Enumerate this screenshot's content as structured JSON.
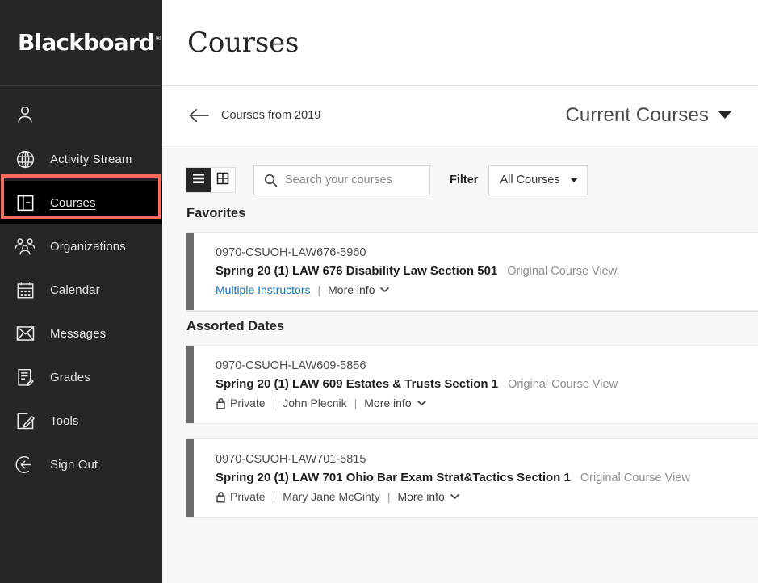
{
  "brand": {
    "logo_text": "Blackboard",
    "accent_highlight": "#fc6a5d",
    "sidebar_bg": "#262626",
    "link_color": "#1d6da8"
  },
  "sidebar": {
    "items": [
      {
        "label": "",
        "icon": "person-icon",
        "name": "profile",
        "active": false
      },
      {
        "label": "Activity Stream",
        "icon": "globe-icon",
        "name": "activity-stream",
        "active": false
      },
      {
        "label": "Courses",
        "icon": "book-icon",
        "name": "courses",
        "active": true
      },
      {
        "label": "Organizations",
        "icon": "people-icon",
        "name": "organizations",
        "active": false
      },
      {
        "label": "Calendar",
        "icon": "calendar-icon",
        "name": "calendar",
        "active": false
      },
      {
        "label": "Messages",
        "icon": "envelope-icon",
        "name": "messages",
        "active": false
      },
      {
        "label": "Grades",
        "icon": "grades-icon",
        "name": "grades",
        "active": false
      },
      {
        "label": "Tools",
        "icon": "tools-pencil-icon",
        "name": "tools",
        "active": false
      },
      {
        "label": "Sign Out",
        "icon": "sign-out-icon",
        "name": "sign-out",
        "active": false
      }
    ]
  },
  "header": {
    "title": "Courses"
  },
  "sub_header": {
    "back_label": "Courses from 2019",
    "back_icon": "arrow-left-icon",
    "term_selected": "Current Courses",
    "term_caret_icon": "chevron-down-icon"
  },
  "toolbar": {
    "list_view_icon": "list-view-icon",
    "grid_view_icon": "grid-view-icon",
    "active_view": "list",
    "search": {
      "icon": "search-icon",
      "value": "",
      "placeholder": "Search your courses"
    },
    "filter_label": "Filter",
    "filter_selected": "All Courses",
    "filter_caret_icon": "chevron-down-icon"
  },
  "sections": [
    {
      "title": "Favorites",
      "courses": [
        {
          "id": "0970-CSUOH-LAW676-5960",
          "name": "Spring 20 (1) LAW 676 Disability Law Section 501",
          "view": "Original Course View",
          "privacy": null,
          "privacy_icon": null,
          "instructor": "Multiple Instructors",
          "instructor_is_link": true,
          "more_info": "More info",
          "more_info_icon": "chevron-down-icon",
          "accent_color": "#6b6b6b"
        }
      ]
    },
    {
      "title": "Assorted Dates",
      "courses": [
        {
          "id": "0970-CSUOH-LAW609-5856",
          "name": "Spring 20 (1) LAW 609 Estates & Trusts Section 1",
          "view": "Original Course View",
          "privacy": "Private",
          "privacy_icon": "lock-icon",
          "instructor": "John Plecnik",
          "instructor_is_link": false,
          "more_info": "More info",
          "more_info_icon": "chevron-down-icon",
          "accent_color": "#6b6b6b"
        },
        {
          "id": "0970-CSUOH-LAW701-5815",
          "name": "Spring 20 (1) LAW 701 Ohio Bar Exam Strat&Tactics Section 1",
          "view": "Original Course View",
          "privacy": "Private",
          "privacy_icon": "lock-icon",
          "instructor": "Mary Jane McGinty",
          "instructor_is_link": false,
          "more_info": "More info",
          "more_info_icon": "chevron-down-icon",
          "accent_color": "#6b6b6b"
        }
      ]
    }
  ]
}
